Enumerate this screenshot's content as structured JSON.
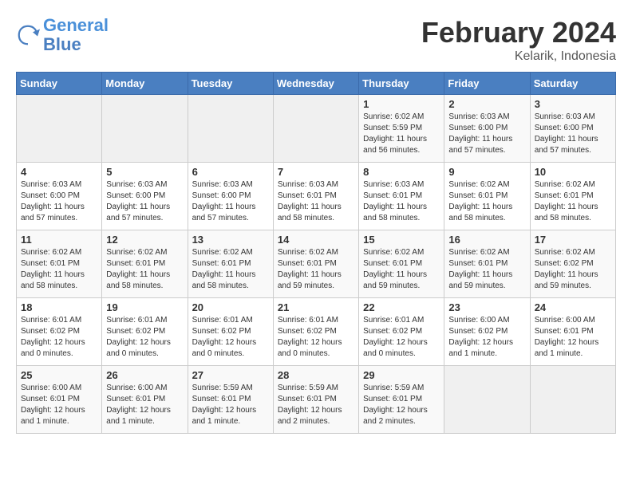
{
  "logo": {
    "line1": "General",
    "line2": "Blue"
  },
  "title": "February 2024",
  "subtitle": "Kelarik, Indonesia",
  "days_of_week": [
    "Sunday",
    "Monday",
    "Tuesday",
    "Wednesday",
    "Thursday",
    "Friday",
    "Saturday"
  ],
  "weeks": [
    [
      {
        "day": "",
        "info": ""
      },
      {
        "day": "",
        "info": ""
      },
      {
        "day": "",
        "info": ""
      },
      {
        "day": "",
        "info": ""
      },
      {
        "day": "1",
        "info": "Sunrise: 6:02 AM\nSunset: 5:59 PM\nDaylight: 11 hours and 56 minutes."
      },
      {
        "day": "2",
        "info": "Sunrise: 6:03 AM\nSunset: 6:00 PM\nDaylight: 11 hours and 57 minutes."
      },
      {
        "day": "3",
        "info": "Sunrise: 6:03 AM\nSunset: 6:00 PM\nDaylight: 11 hours and 57 minutes."
      }
    ],
    [
      {
        "day": "4",
        "info": "Sunrise: 6:03 AM\nSunset: 6:00 PM\nDaylight: 11 hours and 57 minutes."
      },
      {
        "day": "5",
        "info": "Sunrise: 6:03 AM\nSunset: 6:00 PM\nDaylight: 11 hours and 57 minutes."
      },
      {
        "day": "6",
        "info": "Sunrise: 6:03 AM\nSunset: 6:00 PM\nDaylight: 11 hours and 57 minutes."
      },
      {
        "day": "7",
        "info": "Sunrise: 6:03 AM\nSunset: 6:01 PM\nDaylight: 11 hours and 58 minutes."
      },
      {
        "day": "8",
        "info": "Sunrise: 6:03 AM\nSunset: 6:01 PM\nDaylight: 11 hours and 58 minutes."
      },
      {
        "day": "9",
        "info": "Sunrise: 6:02 AM\nSunset: 6:01 PM\nDaylight: 11 hours and 58 minutes."
      },
      {
        "day": "10",
        "info": "Sunrise: 6:02 AM\nSunset: 6:01 PM\nDaylight: 11 hours and 58 minutes."
      }
    ],
    [
      {
        "day": "11",
        "info": "Sunrise: 6:02 AM\nSunset: 6:01 PM\nDaylight: 11 hours and 58 minutes."
      },
      {
        "day": "12",
        "info": "Sunrise: 6:02 AM\nSunset: 6:01 PM\nDaylight: 11 hours and 58 minutes."
      },
      {
        "day": "13",
        "info": "Sunrise: 6:02 AM\nSunset: 6:01 PM\nDaylight: 11 hours and 58 minutes."
      },
      {
        "day": "14",
        "info": "Sunrise: 6:02 AM\nSunset: 6:01 PM\nDaylight: 11 hours and 59 minutes."
      },
      {
        "day": "15",
        "info": "Sunrise: 6:02 AM\nSunset: 6:01 PM\nDaylight: 11 hours and 59 minutes."
      },
      {
        "day": "16",
        "info": "Sunrise: 6:02 AM\nSunset: 6:01 PM\nDaylight: 11 hours and 59 minutes."
      },
      {
        "day": "17",
        "info": "Sunrise: 6:02 AM\nSunset: 6:02 PM\nDaylight: 11 hours and 59 minutes."
      }
    ],
    [
      {
        "day": "18",
        "info": "Sunrise: 6:01 AM\nSunset: 6:02 PM\nDaylight: 12 hours and 0 minutes."
      },
      {
        "day": "19",
        "info": "Sunrise: 6:01 AM\nSunset: 6:02 PM\nDaylight: 12 hours and 0 minutes."
      },
      {
        "day": "20",
        "info": "Sunrise: 6:01 AM\nSunset: 6:02 PM\nDaylight: 12 hours and 0 minutes."
      },
      {
        "day": "21",
        "info": "Sunrise: 6:01 AM\nSunset: 6:02 PM\nDaylight: 12 hours and 0 minutes."
      },
      {
        "day": "22",
        "info": "Sunrise: 6:01 AM\nSunset: 6:02 PM\nDaylight: 12 hours and 0 minutes."
      },
      {
        "day": "23",
        "info": "Sunrise: 6:00 AM\nSunset: 6:02 PM\nDaylight: 12 hours and 1 minute."
      },
      {
        "day": "24",
        "info": "Sunrise: 6:00 AM\nSunset: 6:01 PM\nDaylight: 12 hours and 1 minute."
      }
    ],
    [
      {
        "day": "25",
        "info": "Sunrise: 6:00 AM\nSunset: 6:01 PM\nDaylight: 12 hours and 1 minute."
      },
      {
        "day": "26",
        "info": "Sunrise: 6:00 AM\nSunset: 6:01 PM\nDaylight: 12 hours and 1 minute."
      },
      {
        "day": "27",
        "info": "Sunrise: 5:59 AM\nSunset: 6:01 PM\nDaylight: 12 hours and 1 minute."
      },
      {
        "day": "28",
        "info": "Sunrise: 5:59 AM\nSunset: 6:01 PM\nDaylight: 12 hours and 2 minutes."
      },
      {
        "day": "29",
        "info": "Sunrise: 5:59 AM\nSunset: 6:01 PM\nDaylight: 12 hours and 2 minutes."
      },
      {
        "day": "",
        "info": ""
      },
      {
        "day": "",
        "info": ""
      }
    ]
  ]
}
